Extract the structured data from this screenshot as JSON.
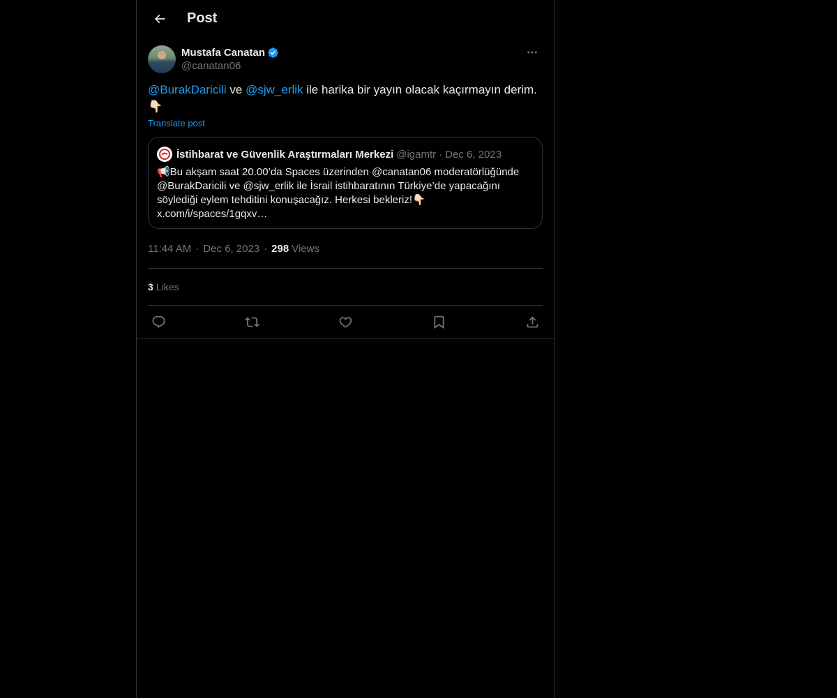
{
  "header": {
    "title": "Post"
  },
  "post": {
    "author": {
      "display_name": "Mustafa Canatan",
      "handle": "@canatan06",
      "verified": true
    },
    "text": {
      "mention1": "@BurakDaricili",
      "connector": " ve ",
      "mention2": "@sjw_erlik",
      "rest": " ile harika bir yayın olacak kaçırmayın derim. 👇🏻"
    },
    "translate_label": "Translate post",
    "quote": {
      "display_name": "İstihbarat ve Güvenlik Araştırmaları Merkezi",
      "handle": "@igamtr",
      "separator": "·",
      "date": "Dec 6, 2023",
      "text": "📢Bu akşam saat 20.00’da Spaces üzerinden @canatan06 moderatörlüğünde @BurakDaricili ve @sjw_erlik ile İsrail istihbaratının Türkiye’de yapacağını söylediği eylem tehditini konuşacağız. Herkesi bekleriz!👇🏻 x.com/i/spaces/1gqxv…"
    },
    "meta": {
      "time": "11:44 AM",
      "dot": "·",
      "date": "Dec 6, 2023",
      "views_count": "298",
      "views_label": "Views"
    },
    "likes": {
      "count": "3",
      "label": "Likes"
    }
  },
  "icons": {
    "back": "arrow-left-icon",
    "verified": "verified-badge-icon",
    "more": "more-horizontal-icon",
    "reply": "reply-icon",
    "repost": "repost-icon",
    "like": "heart-icon",
    "bookmark": "bookmark-icon",
    "share": "share-icon"
  },
  "colors": {
    "background": "#000000",
    "accent": "#1d9bf0",
    "text_primary": "#e7e9ea",
    "text_secondary": "#71767b",
    "border": "#2f3336"
  }
}
